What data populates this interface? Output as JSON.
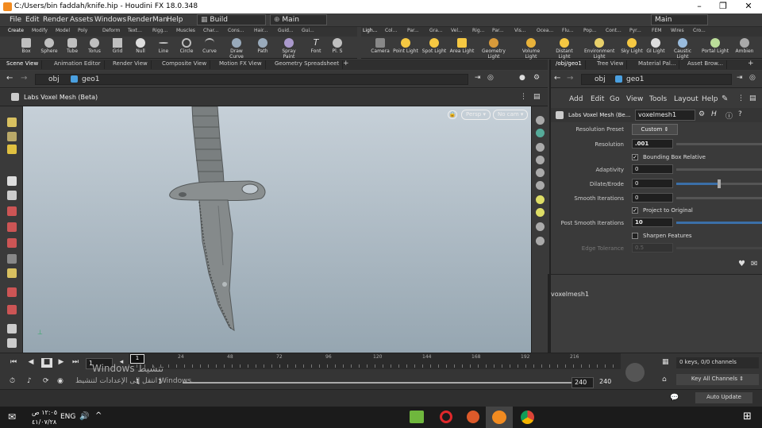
{
  "window": {
    "title": "C:/Users/bin faddah/knife.hip - Houdini FX 18.0.348",
    "minimize": "–",
    "maximize": "❐",
    "close": "✕"
  },
  "menu": {
    "items": [
      "File",
      "Edit",
      "Render",
      "Assets",
      "Windows",
      "RenderMan",
      "Help"
    ],
    "desktop": "Build",
    "desktop_icon": "▦",
    "context": "Main",
    "context_icon": "⊕",
    "right_context": "Main"
  },
  "shelf_left": {
    "tabs": [
      "Create",
      "Modify",
      "Model",
      "Poly",
      "Deform",
      "Text...",
      "Rigg...",
      "Muscles",
      "Char...",
      "Cons...",
      "Hair...",
      "Guid...",
      "Gui..."
    ],
    "tools": [
      "Box",
      "Sphere",
      "Tube",
      "Torus",
      "Grid",
      "Null",
      "Line",
      "Circle",
      "Curve",
      "Draw Curve",
      "Path",
      "Spray Paint",
      "Font",
      "Pl. S"
    ]
  },
  "shelf_right": {
    "tabs": [
      "Ligh...",
      "Col...",
      "Par...",
      "Gra...",
      "Vel...",
      "Rig...",
      "Par...",
      "Vis...",
      "Ocea...",
      "Flu...",
      "Pop...",
      "Cont...",
      "Pyr...",
      "FEM",
      "Wires",
      "Cro..."
    ],
    "tools": [
      "Camera",
      "Point Light",
      "Spot Light",
      "Area Light",
      "Geometry Light",
      "Volume Light",
      "Distant Light",
      "Environment Light",
      "Sky Light",
      "GI Light",
      "Caustic Light",
      "Portal Light",
      "Ambien"
    ]
  },
  "pane_tabs": [
    "Scene View",
    "Animation Editor",
    "Render View",
    "Composite View",
    "Motion FX View",
    "Geometry Spreadsheet"
  ],
  "path": {
    "obj": "obj",
    "geo": "geo1"
  },
  "viewport": {
    "node_title": "Labs Voxel Mesh (Beta)",
    "persp": "Persp",
    "cam": "No cam"
  },
  "timeline": {
    "ticks": [
      "24",
      "48",
      "72",
      "96",
      "120",
      "144",
      "168",
      "192",
      "216"
    ],
    "current_frame": "1",
    "frame_marker": "1",
    "range_start": "1",
    "range_start2": "1",
    "range_end": "240",
    "range_end2": "240",
    "watermark1": "Windows تنشيط",
    "watermark2": "انتقل إلى الإعدادات لتنشيط Windows."
  },
  "right_status": {
    "keys": "0 keys, 0/0 channels",
    "key_all": "Key All Channels",
    "auto_update": "Auto Update"
  },
  "net_tabs": [
    "/obj/geo1",
    "Tree View",
    "Material Pal...",
    "Asset Brow..."
  ],
  "net_path": {
    "obj": "obj",
    "geo": "geo1"
  },
  "net_menu": [
    "Add",
    "Edit",
    "Go",
    "View",
    "Tools",
    "Layout",
    "Help"
  ],
  "params": {
    "node_type": "Labs Voxel Mesh (Be...",
    "node_name": "voxelmesh1",
    "resolution_preset_label": "Resolution Preset",
    "resolution_preset": "Custom",
    "resolution_label": "Resolution",
    "resolution": ".001",
    "bbox_relative": "Bounding Box Relative",
    "adaptivity_label": "Adaptivity",
    "adaptivity": "0",
    "dilate_label": "Dilate/Erode",
    "dilate": "0",
    "smooth_label": "Smooth Iterations",
    "smooth": "0",
    "project": "Project to Original",
    "post_smooth_label": "Post Smooth Iterations",
    "post_smooth": "10",
    "sharpen": "Sharpen Features",
    "edge_label": "Edge Tolerance",
    "edge": "0.5",
    "dilate_slider_fraction": 0.5,
    "post_smooth_slider_fraction": 1.0
  },
  "network": {
    "node_label": "voxelmesh1"
  },
  "taskbar": {
    "time": "١٢:٠٥ ص",
    "date": "٤١/٠٧/٢٨",
    "lang": "ENG"
  }
}
